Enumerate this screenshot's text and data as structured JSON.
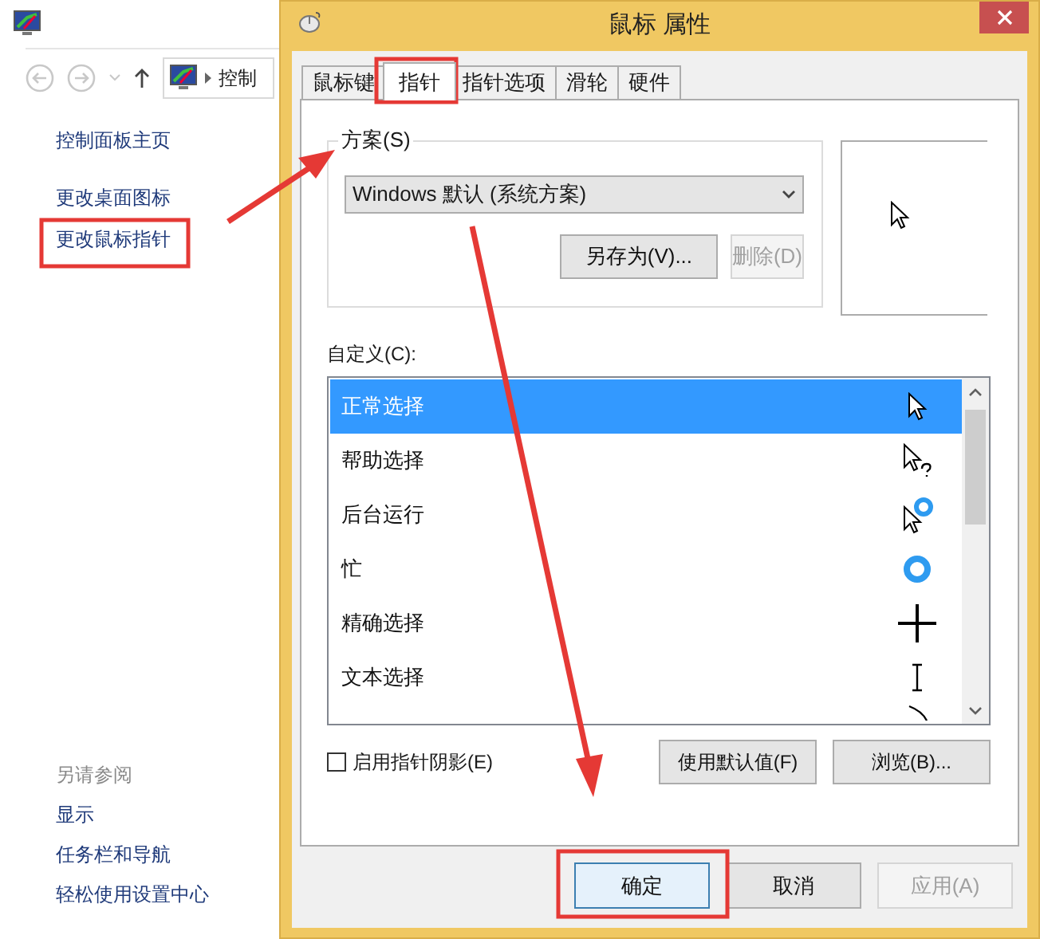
{
  "control_panel": {
    "address_text": "控制",
    "links": [
      {
        "label": "控制面板主页"
      },
      {
        "label": "更改桌面图标"
      },
      {
        "label": "更改鼠标指针"
      }
    ],
    "see_also": {
      "heading": "另请参阅",
      "links": [
        {
          "label": "显示"
        },
        {
          "label": "任务栏和导航"
        },
        {
          "label": "轻松使用设置中心"
        }
      ]
    }
  },
  "dialog": {
    "title": "鼠标 属性",
    "tabs": [
      {
        "label": "鼠标键",
        "selected": false
      },
      {
        "label": "指针",
        "selected": true
      },
      {
        "label": "指针选项",
        "selected": false
      },
      {
        "label": "滑轮",
        "selected": false
      },
      {
        "label": "硬件",
        "selected": false
      }
    ],
    "scheme": {
      "label": "方案(S)",
      "value": "Windows 默认 (系统方案)",
      "buttons": [
        {
          "label": "另存为(V)...",
          "disabled": false
        },
        {
          "label": "删除(D)",
          "disabled": true
        }
      ]
    },
    "customize": {
      "label": "自定义(C):",
      "rows": [
        {
          "label": "正常选择",
          "kind": "arrow",
          "selected": true
        },
        {
          "label": "帮助选择",
          "kind": "help",
          "selected": false
        },
        {
          "label": "后台运行",
          "kind": "working",
          "selected": false
        },
        {
          "label": "忙",
          "kind": "busy",
          "selected": false
        },
        {
          "label": "精确选择",
          "kind": "crosshair",
          "selected": false
        },
        {
          "label": "文本选择",
          "kind": "text",
          "selected": false
        },
        {
          "kind": "pen",
          "selected": false
        }
      ]
    },
    "shadow_checkbox": {
      "label": "启用指针阴影(E)",
      "checked": false
    },
    "panel_buttons": [
      {
        "label": "使用默认值(F)",
        "disabled": false
      },
      {
        "label": "浏览(B)...",
        "disabled": false
      }
    ],
    "buttons": [
      {
        "label": "确定",
        "default": true,
        "disabled": false
      },
      {
        "label": "取消",
        "default": false,
        "disabled": false
      },
      {
        "label": "应用(A)",
        "default": false,
        "disabled": true
      }
    ]
  }
}
